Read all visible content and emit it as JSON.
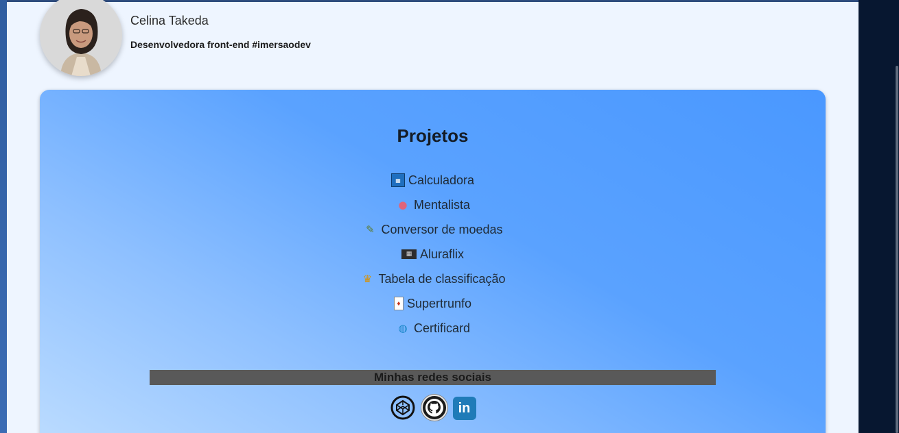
{
  "profile": {
    "name": "Celina Takeda",
    "role": "Desenvolvedora front-end #imersaodev"
  },
  "projects": {
    "title": "Projetos",
    "items": [
      {
        "icon": "calculator-icon",
        "glyph": "1 2\n3 4",
        "label": "Calculadora"
      },
      {
        "icon": "brain-icon",
        "glyph": "●",
        "label": "Mentalista"
      },
      {
        "icon": "currency-exchange-icon",
        "glyph": "✎",
        "label": "Conversor de moedas"
      },
      {
        "icon": "film-icon",
        "glyph": "▦",
        "label": "Aluraflix"
      },
      {
        "icon": "trophy-icon",
        "glyph": "♛",
        "label": "Tabela de classificação"
      },
      {
        "icon": "card-icon",
        "glyph": "♦",
        "label": "Supertrunfo"
      },
      {
        "icon": "globe-icon",
        "glyph": "◍",
        "label": "Certificard"
      }
    ]
  },
  "social": {
    "heading": "Minhas redes sociais",
    "links": [
      {
        "icon": "codepen-icon"
      },
      {
        "icon": "github-icon"
      },
      {
        "icon": "linkedin-icon",
        "text": "in"
      }
    ]
  },
  "colors": {
    "page_bg": "#eef5ff",
    "card_gradient_start": "#bcdcff",
    "card_gradient_end": "#4a98ff",
    "social_bar_bg": "#595959",
    "outer_dark": "#071730"
  }
}
